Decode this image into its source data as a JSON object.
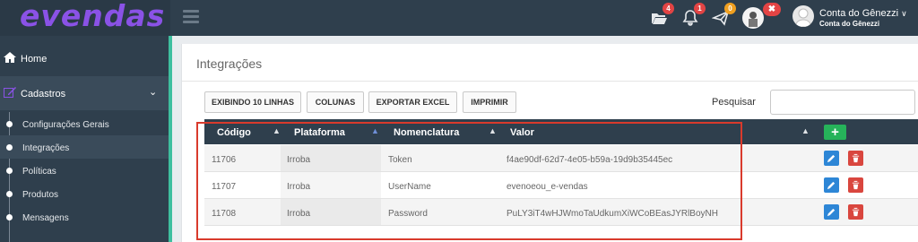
{
  "app": {
    "logo_text": "evendas"
  },
  "topbar": {
    "notifications": [
      {
        "icon": "folder-open-icon",
        "count": "4",
        "color": "#e34444"
      },
      {
        "icon": "bell-icon",
        "count": "1",
        "color": "#e34444"
      },
      {
        "icon": "paper-plane-icon",
        "count": "0",
        "color": "#f0a020"
      }
    ],
    "close_badge": "✖",
    "account": {
      "name": "Conta do Gênezzi",
      "sub": "Conta do Gênezzi"
    }
  },
  "sidebar": {
    "home": "Home",
    "cadastros": "Cadastros",
    "items": [
      {
        "label": "Configurações Gerais"
      },
      {
        "label": "Integrações"
      },
      {
        "label": "Políticas"
      },
      {
        "label": "Produtos"
      },
      {
        "label": "Mensagens"
      }
    ]
  },
  "main": {
    "title": "Integrações",
    "toolbar": {
      "show_rows": "EXIBINDO 10 LINHAS",
      "columns": "COLUNAS",
      "export_excel": "EXPORTAR EXCEL",
      "print": "IMPRIMIR"
    },
    "search": {
      "label": "Pesquisar",
      "value": "",
      "placeholder": ""
    },
    "table": {
      "headers": [
        "Código",
        "Plataforma",
        "Nomenclatura",
        "Valor"
      ],
      "add_label": "+",
      "rows": [
        {
          "codigo": "11706",
          "plataforma": "Irroba",
          "nomenclatura": "Token",
          "valor": "f4ae90df-62d7-4e05-b59a-19d9b35445ec"
        },
        {
          "codigo": "11707",
          "plataforma": "Irroba",
          "nomenclatura": "UserName",
          "valor": "evenoeou_e-vendas"
        },
        {
          "codigo": "11708",
          "plataforma": "Irroba",
          "nomenclatura": "Password",
          "valor": "PuLY3iT4wHJWmoTaUdkumXiWCoBEasJYRlBoyNH"
        }
      ]
    }
  },
  "colors": {
    "sidebar_bg": "#2f3f4d",
    "accent_teal": "#3fbf9f",
    "logo_purple": "#8a52e6",
    "add_green": "#26b35a",
    "edit_blue": "#2d86d6",
    "delete_red": "#d9463e",
    "highlight_red": "#d93a2c"
  }
}
